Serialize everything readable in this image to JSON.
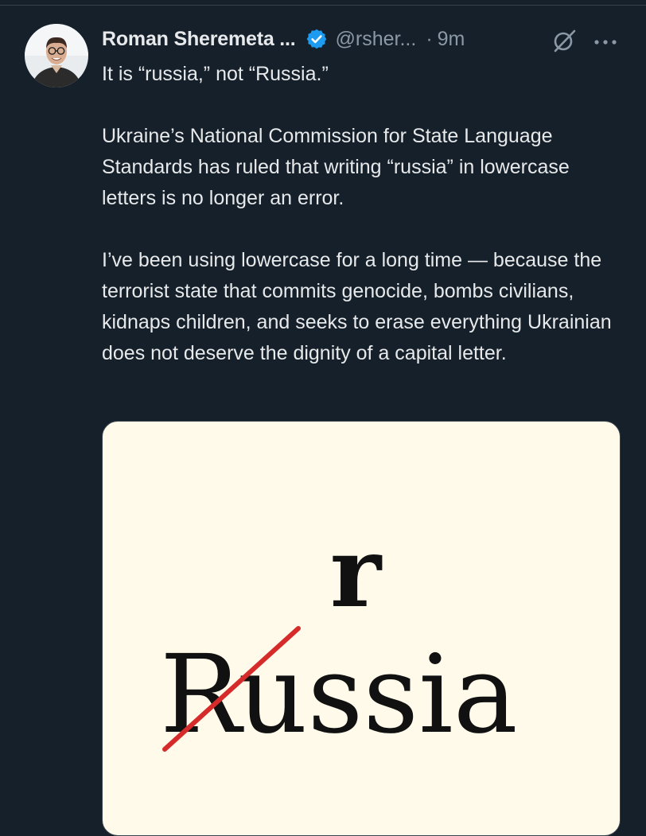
{
  "tweet": {
    "author": {
      "display_name": "Roman Sheremeta ...",
      "handle": "@rsher...",
      "verified_icon": "verified-badge-icon",
      "avatar": "avatar"
    },
    "separator": "·",
    "time": "9m",
    "icons": {
      "grok": "grok-icon",
      "more": "more-icon"
    },
    "text": {
      "line1": "It is “russia,” not “Russia.”",
      "para2": "Ukraine’s National Commission for State Language Standards has ruled that writing “russia” in lowercase letters is no longer an error.",
      "para3": "I’ve been using lowercase for a long time — because the terrorist state that commits genocide, bombs civilians, kidnaps children, and seeks to erase everything Ukrainian does not deserve the dignity of a capital letter."
    },
    "media": {
      "replacement_letter": "r",
      "struck_letter": "R",
      "word_rest": "ussia",
      "background": "#fffaea",
      "strike_color": "#d62b2b"
    }
  },
  "colors": {
    "background": "#15202b",
    "text": "#e7e9ea",
    "secondary_text": "#8b98a5",
    "verified": "#1d9bf0"
  }
}
